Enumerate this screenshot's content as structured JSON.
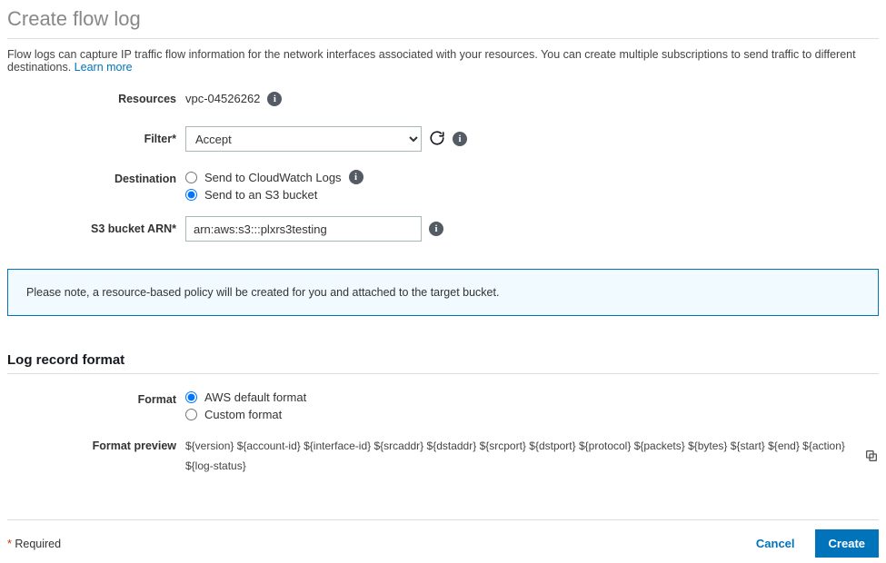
{
  "page": {
    "title": "Create flow log",
    "description": "Flow logs can capture IP traffic flow information for the network interfaces associated with your resources. You can create multiple subscriptions to send traffic to different destinations.",
    "learn_more": "Learn more"
  },
  "form": {
    "resources": {
      "label": "Resources",
      "value": "vpc-04526262"
    },
    "filter": {
      "label": "Filter*",
      "selected": "Accept"
    },
    "destination": {
      "label": "Destination",
      "options": {
        "cloudwatch": "Send to CloudWatch Logs",
        "s3": "Send to an S3 bucket"
      },
      "selected": "s3"
    },
    "s3_arn": {
      "label": "S3 bucket ARN*",
      "value": "arn:aws:s3:::plxrs3testing"
    }
  },
  "note": "Please note, a resource-based policy will be created for you and attached to the target bucket.",
  "log_format": {
    "section_title": "Log record format",
    "format_label": "Format",
    "options": {
      "default": "AWS default format",
      "custom": "Custom format"
    },
    "selected": "default",
    "preview_label": "Format preview",
    "preview_value": "${version} ${account-id} ${interface-id} ${srcaddr} ${dstaddr} ${srcport} ${dstport} ${protocol} ${packets} ${bytes} ${start} ${end} ${action} ${log-status}"
  },
  "footer": {
    "required_hint": "Required",
    "cancel": "Cancel",
    "create": "Create"
  }
}
